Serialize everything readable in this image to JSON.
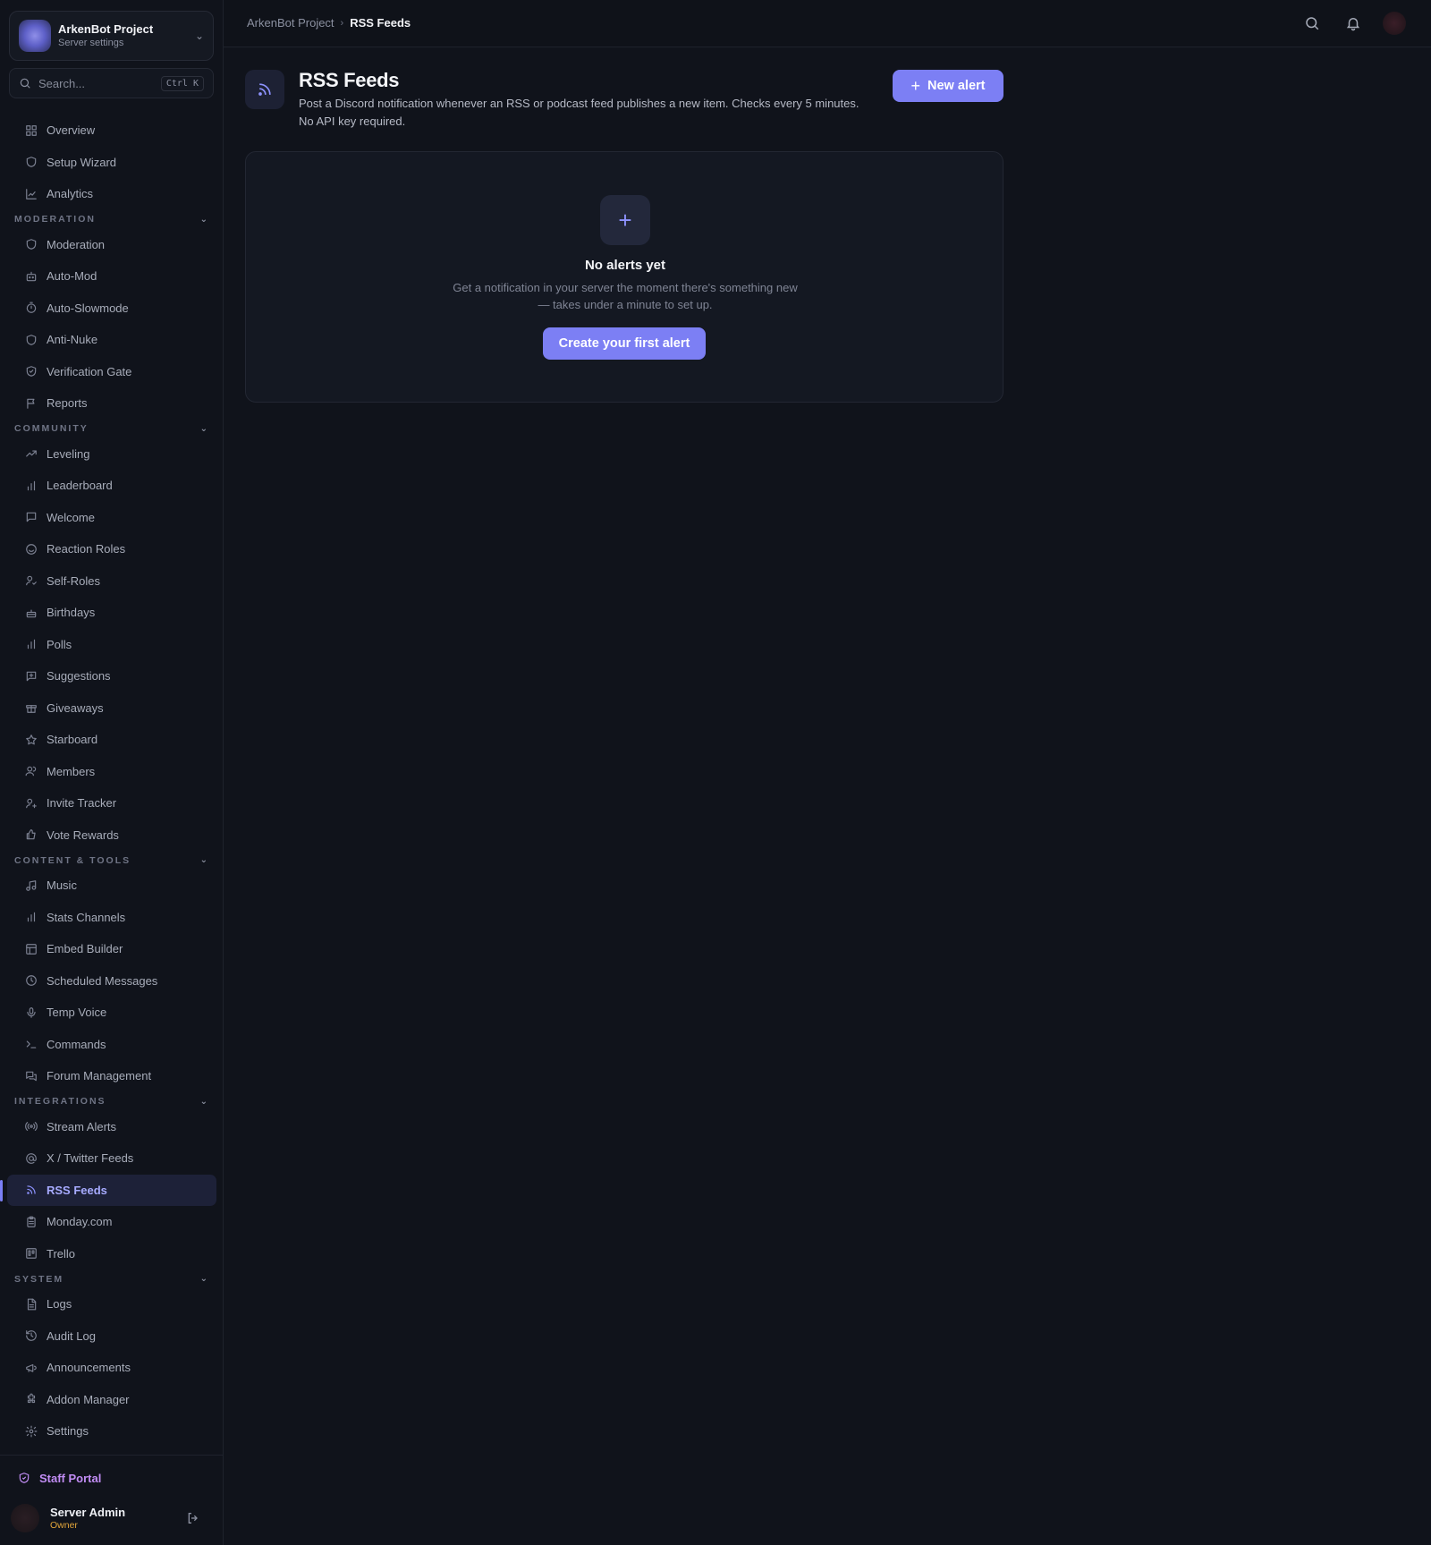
{
  "server": {
    "name": "ArkenBot Project",
    "subtitle": "Server settings"
  },
  "search": {
    "placeholder": "Search...",
    "shortcut": "Ctrl K"
  },
  "nav": {
    "top": [
      {
        "label": "Overview",
        "icon": "grid-icon"
      },
      {
        "label": "Setup Wizard",
        "icon": "shield-icon"
      },
      {
        "label": "Analytics",
        "icon": "line-chart-icon"
      }
    ],
    "sections": [
      {
        "title": "MODERATION",
        "items": [
          {
            "label": "Moderation",
            "icon": "shield-icon"
          },
          {
            "label": "Auto-Mod",
            "icon": "robot-icon"
          },
          {
            "label": "Auto-Slowmode",
            "icon": "timer-icon"
          },
          {
            "label": "Anti-Nuke",
            "icon": "shield-icon"
          },
          {
            "label": "Verification Gate",
            "icon": "shield-check-icon"
          },
          {
            "label": "Reports",
            "icon": "flag-icon"
          }
        ]
      },
      {
        "title": "COMMUNITY",
        "items": [
          {
            "label": "Leveling",
            "icon": "trending-up-icon"
          },
          {
            "label": "Leaderboard",
            "icon": "bar-chart-icon"
          },
          {
            "label": "Welcome",
            "icon": "message-icon"
          },
          {
            "label": "Reaction Roles",
            "icon": "smile-icon"
          },
          {
            "label": "Self-Roles",
            "icon": "user-check-icon"
          },
          {
            "label": "Birthdays",
            "icon": "cake-icon"
          },
          {
            "label": "Polls",
            "icon": "bar-chart-icon"
          },
          {
            "label": "Suggestions",
            "icon": "message-plus-icon"
          },
          {
            "label": "Giveaways",
            "icon": "gift-icon"
          },
          {
            "label": "Starboard",
            "icon": "star-icon"
          },
          {
            "label": "Members",
            "icon": "users-icon"
          },
          {
            "label": "Invite Tracker",
            "icon": "user-plus-icon"
          },
          {
            "label": "Vote Rewards",
            "icon": "thumbs-up-icon"
          }
        ]
      },
      {
        "title": "CONTENT & TOOLS",
        "items": [
          {
            "label": "Music",
            "icon": "music-icon"
          },
          {
            "label": "Stats Channels",
            "icon": "bar-chart-icon"
          },
          {
            "label": "Embed Builder",
            "icon": "layout-icon"
          },
          {
            "label": "Scheduled Messages",
            "icon": "clock-icon"
          },
          {
            "label": "Temp Voice",
            "icon": "mic-icon"
          },
          {
            "label": "Commands",
            "icon": "terminal-icon"
          },
          {
            "label": "Forum Management",
            "icon": "messages-icon"
          }
        ]
      },
      {
        "title": "INTEGRATIONS",
        "items": [
          {
            "label": "Stream Alerts",
            "icon": "broadcast-icon"
          },
          {
            "label": "X / Twitter Feeds",
            "icon": "at-sign-icon"
          },
          {
            "label": "RSS Feeds",
            "icon": "rss-icon",
            "active": true
          },
          {
            "label": "Monday.com",
            "icon": "clipboard-icon"
          },
          {
            "label": "Trello",
            "icon": "trello-icon"
          }
        ]
      },
      {
        "title": "SYSTEM",
        "items": [
          {
            "label": "Logs",
            "icon": "file-text-icon"
          },
          {
            "label": "Audit Log",
            "icon": "history-icon"
          },
          {
            "label": "Announcements",
            "icon": "megaphone-icon"
          },
          {
            "label": "Addon Manager",
            "icon": "puzzle-icon"
          },
          {
            "label": "Settings",
            "icon": "gear-icon"
          }
        ]
      }
    ]
  },
  "footer": {
    "staff_label": "Staff Portal",
    "user_name": "Server Admin",
    "user_role": "Owner"
  },
  "breadcrumb": {
    "parent": "ArkenBot Project",
    "current": "RSS Feeds"
  },
  "page": {
    "title": "RSS Feeds",
    "description": "Post a Discord notification whenever an RSS or podcast feed publishes a new item. Checks every 5 minutes. No API key required.",
    "new_button": "New alert"
  },
  "empty": {
    "title": "No alerts yet",
    "description": "Get a notification in your server the moment there's something new — takes under a minute to set up.",
    "button": "Create your first alert"
  },
  "colors": {
    "accent": "#7c7ff4",
    "background": "#10131b",
    "owner": "#e0a43a",
    "staff": "#c28df5"
  }
}
